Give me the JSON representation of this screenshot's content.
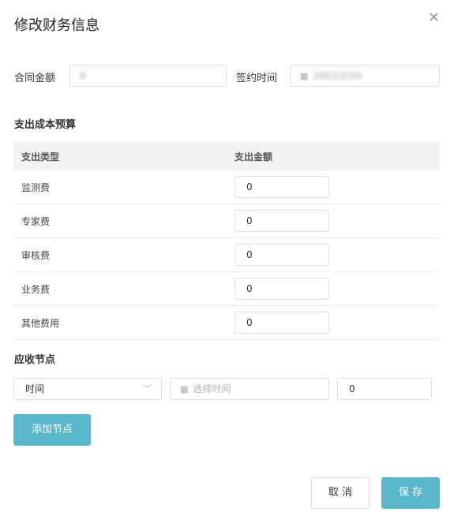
{
  "dialog": {
    "title": "修改财务信息"
  },
  "contract": {
    "amount_label": "合同金额",
    "amount_value": "0",
    "sign_label": "签约时间",
    "sign_value": "2022/2/10"
  },
  "budget": {
    "section_title": "支出成本预算",
    "headers": {
      "type": "支出类型",
      "amount": "支出金额"
    },
    "rows": [
      {
        "type": "监测费",
        "amount": "0"
      },
      {
        "type": "专家费",
        "amount": "0"
      },
      {
        "type": "审核费",
        "amount": "0"
      },
      {
        "type": "业务费",
        "amount": "0"
      },
      {
        "type": "其他费用",
        "amount": "0"
      }
    ]
  },
  "receivable": {
    "section_title": "应收节点",
    "node_select": "时间",
    "date_placeholder": "选择时间",
    "amount_value": "0",
    "add_button": "添加节点"
  },
  "footer": {
    "cancel": "取 消",
    "save": "保 存"
  },
  "icons": {
    "close": "close-icon",
    "calendar": "calendar-icon",
    "chevron": "chevron-down-icon"
  },
  "colors": {
    "primary": "#5ab7c9"
  }
}
